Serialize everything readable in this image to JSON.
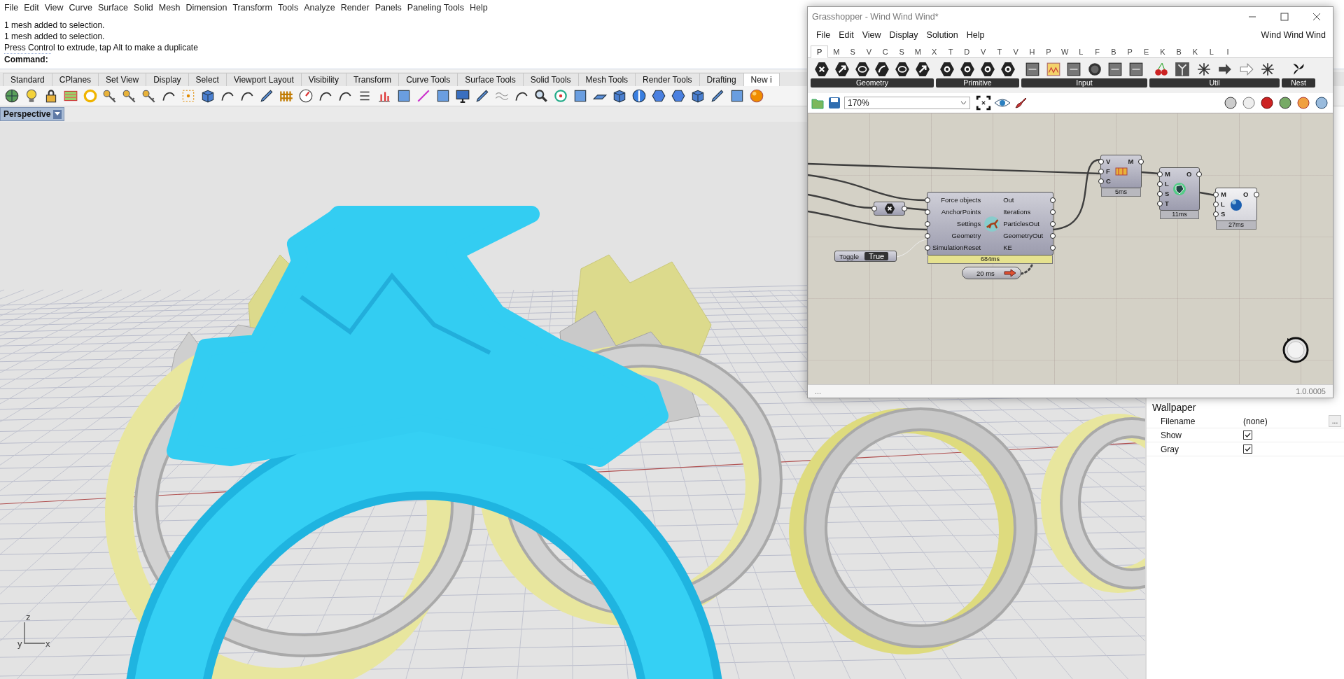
{
  "rhino": {
    "menu": [
      "File",
      "Edit",
      "View",
      "Curve",
      "Surface",
      "Solid",
      "Mesh",
      "Dimension",
      "Transform",
      "Tools",
      "Analyze",
      "Render",
      "Panels",
      "Paneling Tools",
      "Help"
    ],
    "command_history": [
      "1 mesh added to selection.",
      "1 mesh added to selection.",
      "Press Control to extrude, tap Alt to make a duplicate"
    ],
    "command_prompt": "Command:",
    "toolbar_tabs": [
      {
        "label": "Standard",
        "selected": false
      },
      {
        "label": "CPlanes",
        "selected": false
      },
      {
        "label": "Set View",
        "selected": false
      },
      {
        "label": "Display",
        "selected": false
      },
      {
        "label": "Select",
        "selected": false
      },
      {
        "label": "Viewport Layout",
        "selected": false
      },
      {
        "label": "Visibility",
        "selected": false
      },
      {
        "label": "Transform",
        "selected": false
      },
      {
        "label": "Curve Tools",
        "selected": false
      },
      {
        "label": "Surface Tools",
        "selected": false
      },
      {
        "label": "Solid Tools",
        "selected": false
      },
      {
        "label": "Mesh Tools",
        "selected": false
      },
      {
        "label": "Render Tools",
        "selected": false
      },
      {
        "label": "Drafting",
        "selected": false
      },
      {
        "label": "New i",
        "selected": true
      }
    ],
    "viewport": {
      "title": "Perspective",
      "axes": [
        "z",
        "y",
        "x"
      ]
    }
  },
  "properties": {
    "section": "Wallpaper",
    "rows": [
      {
        "kind": "text",
        "label": "Filename",
        "value": "(none)",
        "button": "..."
      },
      {
        "kind": "checkbox",
        "label": "Show",
        "checked": true
      },
      {
        "kind": "checkbox",
        "label": "Gray",
        "checked": true
      }
    ]
  },
  "grasshopper": {
    "title": "Grasshopper - Wind Wind Wind*",
    "menu": [
      "File",
      "Edit",
      "View",
      "Display",
      "Solution",
      "Help"
    ],
    "document_name": "Wind Wind Wind",
    "tabs": [
      {
        "label": "P",
        "selected": true
      },
      {
        "label": "M",
        "selected": false
      },
      {
        "label": "S",
        "selected": false
      },
      {
        "label": "V",
        "selected": false
      },
      {
        "label": "C",
        "selected": false
      },
      {
        "label": "S",
        "selected": false
      },
      {
        "label": "M",
        "selected": false
      },
      {
        "label": "X",
        "selected": false
      },
      {
        "label": "T",
        "selected": false
      },
      {
        "label": "D",
        "selected": false
      },
      {
        "label": "V",
        "selected": false
      },
      {
        "label": "T",
        "selected": false
      },
      {
        "label": "V",
        "selected": false
      },
      {
        "label": "H",
        "selected": false
      },
      {
        "label": "P",
        "selected": false
      },
      {
        "label": "W",
        "selected": false
      },
      {
        "label": "L",
        "selected": false
      },
      {
        "label": "F",
        "selected": false
      },
      {
        "label": "B",
        "selected": false
      },
      {
        "label": "P",
        "selected": false
      },
      {
        "label": "E",
        "selected": false
      },
      {
        "label": "K",
        "selected": false
      },
      {
        "label": "B",
        "selected": false
      },
      {
        "label": "K",
        "selected": false
      },
      {
        "label": "L",
        "selected": false
      },
      {
        "label": "I",
        "selected": false
      }
    ],
    "ribbon_groups": [
      "Geometry",
      "Primitive",
      "Input",
      "Util",
      "Nest"
    ],
    "zoom": "170%",
    "nodes": [
      {
        "kind": "toggle",
        "label": "Toggle",
        "value": "True"
      },
      {
        "kind": "param"
      },
      {
        "kind": "solver",
        "inputs": [
          "Force objects",
          "AnchorPoints",
          "Settings",
          "Geometry",
          "SimulationReset"
        ],
        "outputs": [
          "Out",
          "Iterations",
          "ParticlesOut",
          "GeometryOut",
          "KE"
        ],
        "time": "684ms"
      },
      {
        "kind": "timer",
        "label": "20 ms"
      },
      {
        "kind": "component",
        "inputs": [
          "V",
          "F",
          "C"
        ],
        "outputs": [
          "M"
        ],
        "time": "5ms"
      },
      {
        "kind": "component",
        "inputs": [
          "M",
          "L",
          "S",
          "T"
        ],
        "outputs": [
          "O"
        ],
        "time": "11ms"
      },
      {
        "kind": "component",
        "inputs": [
          "M",
          "L",
          "S"
        ],
        "outputs": [
          "O"
        ],
        "time": "27ms"
      }
    ],
    "status_left": "...",
    "version": "1.0.0005"
  }
}
